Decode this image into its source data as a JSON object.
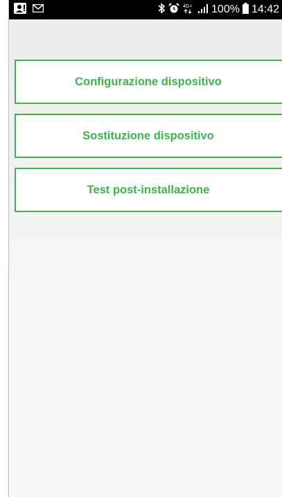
{
  "status_bar": {
    "icons_left": [
      "user-alert-icon",
      "mail-icon"
    ],
    "icons_right": [
      "bluetooth-icon",
      "alarm-icon",
      "network-4g-icon",
      "signal-icon"
    ],
    "network_label": "4G+",
    "battery_percent": "100%",
    "time": "14:42"
  },
  "menu": {
    "items": [
      {
        "label": "Configurazione dispositivo"
      },
      {
        "label": "Sostituzione dispositivo"
      },
      {
        "label": "Test post-installazione"
      }
    ]
  },
  "colors": {
    "accent": "#3bb54a",
    "status_bar_bg": "#000000",
    "background": "#ededed"
  }
}
